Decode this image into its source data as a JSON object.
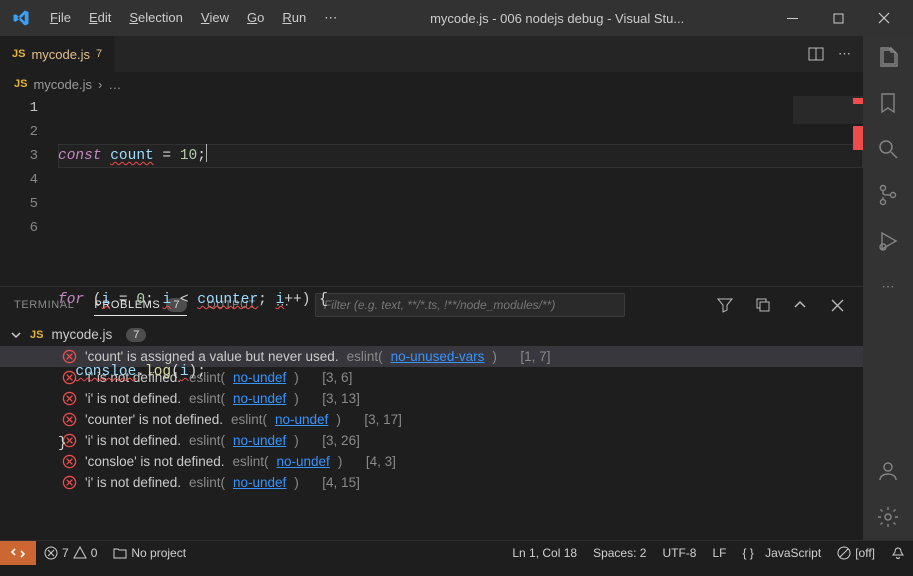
{
  "window": {
    "title": "mycode.js - 006 nodejs debug - Visual Stu..."
  },
  "menu": {
    "file": "File",
    "edit": "Edit",
    "selection": "Selection",
    "view": "View",
    "go": "Go",
    "run": "Run"
  },
  "tab": {
    "filename": "mycode.js",
    "dirty": "7",
    "js": "JS"
  },
  "breadcrumb": {
    "js": "JS",
    "file": "mycode.js"
  },
  "code": {
    "l1": {
      "kw": "const",
      "id": "count",
      "eq": " = ",
      "num": "10",
      "semi": ";"
    },
    "l3": {
      "kw": "for",
      "open": " (",
      "i1": "i",
      "asn": " = ",
      "zero": "0",
      "s1": "; ",
      "i2": "i",
      "lt": " < ",
      "ctr": "counter",
      "s2": "; ",
      "i3": "i",
      "inc": "++",
      "close": ") {",
      "brace": ""
    },
    "l4": {
      "obj": "consloe",
      "dot": ".",
      "fn": "log",
      "open": "(",
      "arg": "i",
      "close": ");"
    },
    "l5": {
      "brace": "}"
    }
  },
  "lines": {
    "1": "1",
    "2": "2",
    "3": "3",
    "4": "4",
    "5": "5",
    "6": "6"
  },
  "panel": {
    "terminal": "Terminal",
    "problems": "Problems",
    "problemsCount": "7",
    "output": "Output",
    "filterPlaceholder": "Filter (e.g. text, **/*.ts, !**/node_modules/**)",
    "fileJs": "JS",
    "filename": "mycode.js",
    "fileCount": "7"
  },
  "problems": [
    {
      "msg": "'count' is assigned a value but never used.",
      "src": "eslint",
      "rule": "no-unused-vars",
      "loc": "[1, 7]"
    },
    {
      "msg": "'i' is not defined.",
      "src": "eslint",
      "rule": "no-undef",
      "loc": "[3, 6]"
    },
    {
      "msg": "'i' is not defined.",
      "src": "eslint",
      "rule": "no-undef",
      "loc": "[3, 13]"
    },
    {
      "msg": "'counter' is not defined.",
      "src": "eslint",
      "rule": "no-undef",
      "loc": "[3, 17]"
    },
    {
      "msg": "'i' is not defined.",
      "src": "eslint",
      "rule": "no-undef",
      "loc": "[3, 26]"
    },
    {
      "msg": "'consloe' is not defined.",
      "src": "eslint",
      "rule": "no-undef",
      "loc": "[4, 3]"
    },
    {
      "msg": "'i' is not defined.",
      "src": "eslint",
      "rule": "no-undef",
      "loc": "[4, 15]"
    }
  ],
  "status": {
    "errors": "7",
    "warnings": "0",
    "folder": "No project",
    "lncol": "Ln 1, Col 18",
    "spaces": "Spaces: 2",
    "encoding": "UTF-8",
    "eol": "LF",
    "lang": "JavaScript",
    "eslint": "[off]"
  }
}
